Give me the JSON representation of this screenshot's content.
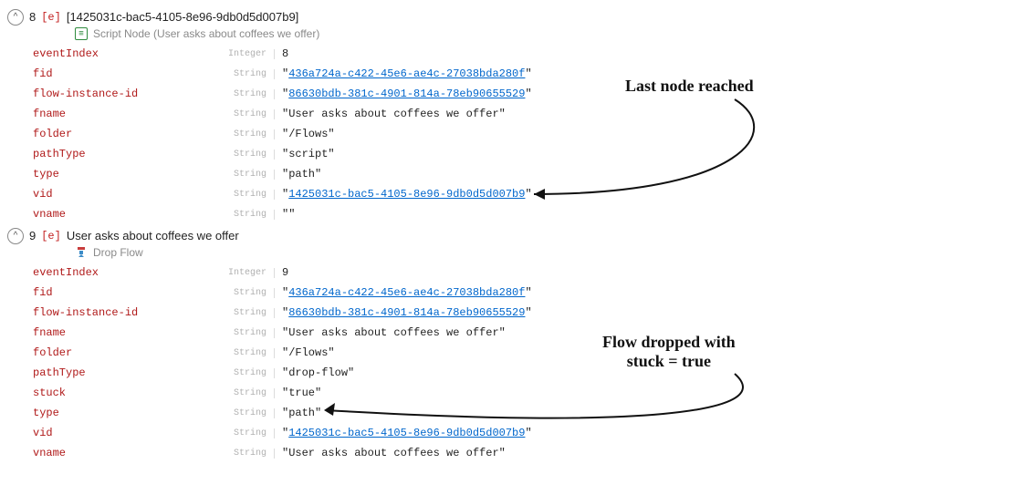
{
  "events": [
    {
      "index": "8",
      "tag": "[e]",
      "title": "[1425031c-bac5-4105-8e96-9db0d5d007b9]",
      "sub": "Script Node (User asks about coffees we offer)",
      "subIcon": "script",
      "rows": [
        {
          "key": "eventIndex",
          "type": "Integer",
          "value": "8",
          "link": false
        },
        {
          "key": "fid",
          "type": "String",
          "value": "436a724a-c422-45e6-ae4c-27038bda280f",
          "link": true
        },
        {
          "key": "flow-instance-id",
          "type": "String",
          "value": "86630bdb-381c-4901-814a-78eb90655529",
          "link": true
        },
        {
          "key": "fname",
          "type": "String",
          "value": "User asks about coffees we offer",
          "link": false
        },
        {
          "key": "folder",
          "type": "String",
          "value": "/Flows",
          "link": false
        },
        {
          "key": "pathType",
          "type": "String",
          "value": "script",
          "link": false
        },
        {
          "key": "type",
          "type": "String",
          "value": "path",
          "link": false
        },
        {
          "key": "vid",
          "type": "String",
          "value": "1425031c-bac5-4105-8e96-9db0d5d007b9",
          "link": true
        },
        {
          "key": "vname",
          "type": "String",
          "value": "",
          "link": false
        }
      ]
    },
    {
      "index": "9",
      "tag": "[e]",
      "title": "User asks about coffees we offer",
      "sub": "Drop Flow",
      "subIcon": "drop",
      "rows": [
        {
          "key": "eventIndex",
          "type": "Integer",
          "value": "9",
          "link": false
        },
        {
          "key": "fid",
          "type": "String",
          "value": "436a724a-c422-45e6-ae4c-27038bda280f",
          "link": true
        },
        {
          "key": "flow-instance-id",
          "type": "String",
          "value": "86630bdb-381c-4901-814a-78eb90655529",
          "link": true
        },
        {
          "key": "fname",
          "type": "String",
          "value": "User asks about coffees we offer",
          "link": false
        },
        {
          "key": "folder",
          "type": "String",
          "value": "/Flows",
          "link": false
        },
        {
          "key": "pathType",
          "type": "String",
          "value": "drop-flow",
          "link": false
        },
        {
          "key": "stuck",
          "type": "String",
          "value": "true",
          "link": false
        },
        {
          "key": "type",
          "type": "String",
          "value": "path",
          "link": false
        },
        {
          "key": "vid",
          "type": "String",
          "value": "1425031c-bac5-4105-8e96-9db0d5d007b9",
          "link": true
        },
        {
          "key": "vname",
          "type": "String",
          "value": "User asks about coffees we offer",
          "link": false
        }
      ]
    }
  ],
  "annotations": {
    "a1": "Last node reached",
    "a2_line1": "Flow dropped with",
    "a2_line2": "stuck = true"
  },
  "glyphs": {
    "chevron": "^",
    "script": "≡"
  }
}
